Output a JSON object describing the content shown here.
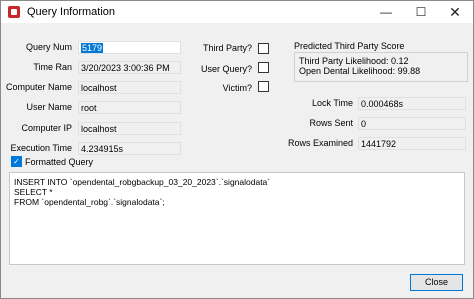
{
  "window": {
    "title": "Query Information",
    "minimize_icon": "minimize-icon",
    "maximize_icon": "maximize-icon",
    "close_icon": "close-icon"
  },
  "fields": {
    "query_num": {
      "label": "Query Num",
      "value": "5179"
    },
    "time_ran": {
      "label": "Time Ran",
      "value": "3/20/2023 3:00:36 PM"
    },
    "computer_name": {
      "label": "Computer Name",
      "value": "localhost"
    },
    "user_name": {
      "label": "User Name",
      "value": "root"
    },
    "computer_ip": {
      "label": "Computer IP",
      "value": "localhost"
    },
    "execution_time": {
      "label": "Execution Time",
      "value": "4.234915s"
    }
  },
  "flags": {
    "third_party": {
      "label": "Third Party?",
      "checked": false
    },
    "user_query": {
      "label": "User Query?",
      "checked": false
    },
    "victim": {
      "label": "Victim?",
      "checked": false
    }
  },
  "score": {
    "heading": "Predicted Third Party Score",
    "third_party_likelihood": "Third Party Likelihood: 0.12",
    "open_dental_likelihood": "Open Dental Likelihood: 99.88"
  },
  "stats": {
    "lock_time": {
      "label": "Lock Time",
      "value": "0.000468s"
    },
    "rows_sent": {
      "label": "Rows Sent",
      "value": "0"
    },
    "rows_examined": {
      "label": "Rows Examined",
      "value": "1441792"
    }
  },
  "formatted_query": {
    "label": "Formatted Query",
    "checked": true
  },
  "query_text": "INSERT INTO `opendental_robgbackup_03_20_2023`.`signalodata`\nSELECT *\nFROM `opendental_robg`.`signalodata`;",
  "close_button": {
    "label": "Close"
  }
}
